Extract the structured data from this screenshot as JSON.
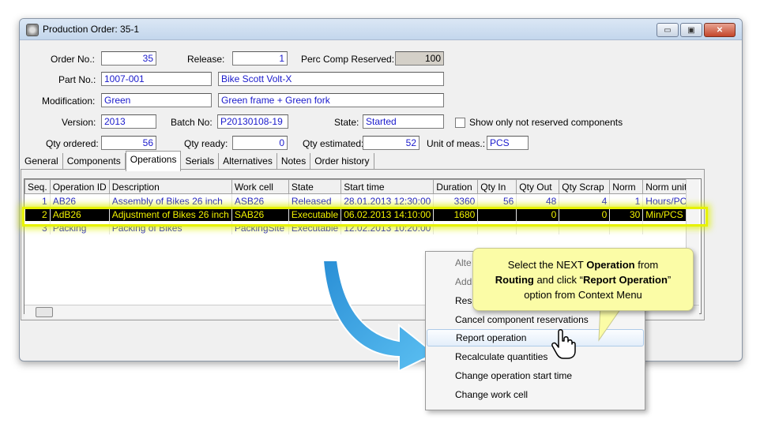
{
  "window": {
    "title": "Production Order: 35-1",
    "min": "▭",
    "max": "▣",
    "close": "✕"
  },
  "form": {
    "order_no_label": "Order No.:",
    "order_no": "35",
    "release_label": "Release:",
    "release": "1",
    "perc_label": "Perc Comp Reserved:",
    "perc": "100",
    "part_no_label": "Part No.:",
    "part_no": "1007-001",
    "part_desc": "Bike Scott Volt-X",
    "modification_label": "Modification:",
    "modification": "Green",
    "modification_desc": "Green frame + Green fork",
    "version_label": "Version:",
    "version": "2013",
    "batch_label": "Batch No:",
    "batch": "P20130108-19",
    "state_label": "State:",
    "state": "Started",
    "show_only_label": "Show only not reserved components",
    "qty_ordered_label": "Qty ordered:",
    "qty_ordered": "56",
    "qty_ready_label": "Qty ready:",
    "qty_ready": "0",
    "qty_estimated_label": "Qty estimated:",
    "qty_estimated": "52",
    "unit_label": "Unit of meas.:",
    "unit": "PCS"
  },
  "tabs": [
    "General",
    "Components",
    "Operations",
    "Serials",
    "Alternatives",
    "Notes",
    "Order history"
  ],
  "columns": [
    "Seq.",
    "Operation ID",
    "Description",
    "Work cell",
    "State",
    "Start time",
    "Duration",
    "Qty In",
    "Qty Out",
    "Qty Scrap",
    "Norm",
    "Norm unit"
  ],
  "rows": [
    [
      "1",
      "AB26",
      "Assembly of Bikes 26 inch",
      "ASB26",
      "Released",
      "28.01.2013 12:30:00",
      "3360",
      "56",
      "48",
      "4",
      "1",
      "Hours/PCS"
    ],
    [
      "2",
      "AdB26",
      "Adjustment of Bikes 26 inch",
      "SAB26",
      "Executable",
      "06.02.2013 14:10:00",
      "1680",
      "",
      "0",
      "0",
      "30",
      "Min/PCS"
    ],
    [
      "3",
      "Packing",
      "Packing of Bikes",
      "PackingSite",
      "Executable",
      "12.02.2013 10:20:00",
      "",
      "",
      "",
      "",
      "",
      ""
    ]
  ],
  "context_menu": [
    "Alte",
    "Add",
    "Res",
    "Cancel component reservations",
    "Report operation",
    "Recalculate quantities",
    "Change operation start time",
    "Change work cell"
  ],
  "callout": {
    "line1_pre": "Select the NEXT ",
    "line1_bold": "Operation",
    "line1_post": " from",
    "line2_bold1": "Routing",
    "line2_mid": " and click “",
    "line2_bold2": "Report Operation",
    "line2_post": "”",
    "line3": "option from Context Menu"
  },
  "colors": {
    "accent": "#1a1acc",
    "selected_bg": "#000000",
    "selected_fg": "#f0f000",
    "highlight": "#e6f200",
    "callout_bg": "#fbfca6",
    "arrow": "#3da5e3"
  },
  "icons": {
    "app": "gear-icon",
    "cursor": "hand-pointer-icon",
    "arrow": "curved-arrow-icon"
  }
}
